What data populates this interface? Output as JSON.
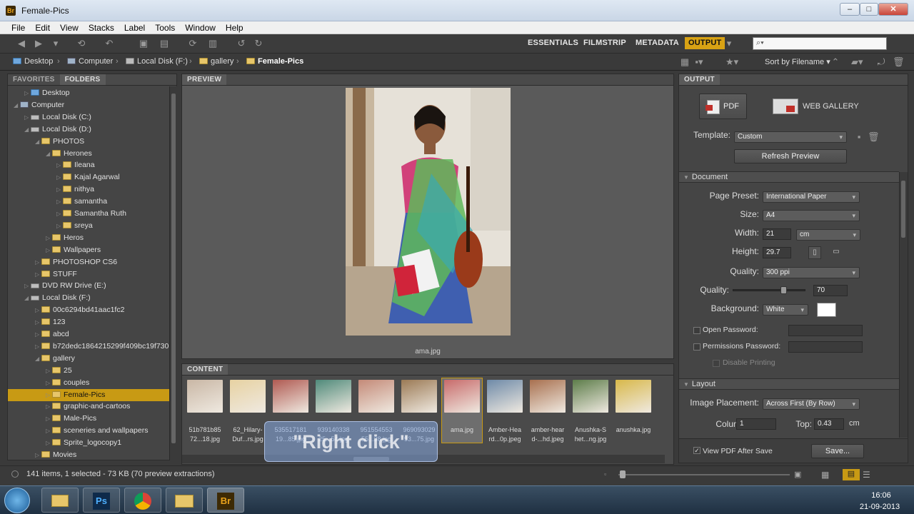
{
  "window": {
    "title": "Female-Pics",
    "app_icon": "Br"
  },
  "menu": [
    "File",
    "Edit",
    "View",
    "Stacks",
    "Label",
    "Tools",
    "Window",
    "Help"
  ],
  "workspaces": [
    "ESSENTIALS",
    "FILMSTRIP",
    "METADATA",
    "OUTPUT"
  ],
  "search": {
    "placeholder": ""
  },
  "path": [
    "Desktop",
    "Computer",
    "Local Disk (F:)",
    "gallery",
    "Female-Pics"
  ],
  "sort_label": "Sort by Filename",
  "left_tabs": [
    "FAVORITES",
    "FOLDERS"
  ],
  "folders": [
    {
      "label": "Desktop",
      "indent": 1,
      "icon": "desktop"
    },
    {
      "label": "Computer",
      "indent": 0,
      "icon": "computer",
      "open": true
    },
    {
      "label": "Local Disk (C:)",
      "indent": 1,
      "icon": "drive"
    },
    {
      "label": "Local Disk (D:)",
      "indent": 1,
      "icon": "drive",
      "open": true
    },
    {
      "label": "PHOTOS",
      "indent": 2,
      "icon": "folder",
      "open": true
    },
    {
      "label": "Herones",
      "indent": 3,
      "icon": "folder",
      "open": true
    },
    {
      "label": "Ileana",
      "indent": 4,
      "icon": "folder"
    },
    {
      "label": "Kajal Agarwal",
      "indent": 4,
      "icon": "folder"
    },
    {
      "label": "nithya",
      "indent": 4,
      "icon": "folder"
    },
    {
      "label": "samantha",
      "indent": 4,
      "icon": "folder"
    },
    {
      "label": "Samantha Ruth",
      "indent": 4,
      "icon": "folder"
    },
    {
      "label": "sreya",
      "indent": 4,
      "icon": "folder"
    },
    {
      "label": "Heros",
      "indent": 3,
      "icon": "folder"
    },
    {
      "label": "Wallpapers",
      "indent": 3,
      "icon": "folder"
    },
    {
      "label": "PHOTOSHOP CS6",
      "indent": 2,
      "icon": "folder"
    },
    {
      "label": "STUFF",
      "indent": 2,
      "icon": "folder"
    },
    {
      "label": "DVD RW Drive (E:)",
      "indent": 1,
      "icon": "drive"
    },
    {
      "label": "Local Disk (F:)",
      "indent": 1,
      "icon": "drive",
      "open": true
    },
    {
      "label": "00c6294bd41aac1fc2",
      "indent": 2,
      "icon": "folder"
    },
    {
      "label": "123",
      "indent": 2,
      "icon": "folder"
    },
    {
      "label": "abcd",
      "indent": 2,
      "icon": "folder"
    },
    {
      "label": "b72dedc1864215299f409bc19f730",
      "indent": 2,
      "icon": "folder"
    },
    {
      "label": "gallery",
      "indent": 2,
      "icon": "folder",
      "open": true
    },
    {
      "label": "25",
      "indent": 3,
      "icon": "folder"
    },
    {
      "label": "couples",
      "indent": 3,
      "icon": "folder"
    },
    {
      "label": "Female-Pics",
      "indent": 3,
      "icon": "folder",
      "selected": true
    },
    {
      "label": "graphic-and-cartoos",
      "indent": 3,
      "icon": "folder"
    },
    {
      "label": "Male-Pics",
      "indent": 3,
      "icon": "folder"
    },
    {
      "label": "sceneries and wallpapers",
      "indent": 3,
      "icon": "folder"
    },
    {
      "label": "Sprite_logocopy1",
      "indent": 3,
      "icon": "folder"
    },
    {
      "label": "Movies",
      "indent": 2,
      "icon": "folder"
    }
  ],
  "preview": {
    "header": "PREVIEW",
    "filename": "ama.jpg"
  },
  "content": {
    "header": "CONTENT",
    "thumbs": [
      {
        "cap": "51b781b85\n72...18.jpg",
        "color": "#c9b7a5"
      },
      {
        "cap": "62_Hilary-\nDuf...rs.jpg",
        "color": "#e7d2a2"
      },
      {
        "cap": "535517181\n19...85.jpg",
        "color": "#b05a52"
      },
      {
        "cap": "939140338\n25...54.jpg",
        "color": "#4f8a7a"
      },
      {
        "cap": "951554553\n55...38.jpg",
        "color": "#c48a78"
      },
      {
        "cap": "969093029\n93...75.jpg",
        "color": "#9b7a55"
      },
      {
        "cap": "ama.jpg",
        "color": "#c86b6b",
        "selected": true
      },
      {
        "cap": "Amber-Hea\nrd...0p.jpeg",
        "color": "#6e8aa8"
      },
      {
        "cap": "amber-hear\nd-...hd.jpeg",
        "color": "#a8704f"
      },
      {
        "cap": "Anushka-S\nhet...ng.jpg",
        "color": "#5d7d4a"
      },
      {
        "cap": "anushka.jpg",
        "color": "#d8b84a"
      }
    ],
    "overlay": "\"Right click\""
  },
  "output": {
    "header": "OUTPUT",
    "pdf_label": "PDF",
    "web_label": "WEB GALLERY",
    "template_label": "Template:",
    "template_value": "Custom",
    "refresh_label": "Refresh Preview",
    "document_section": "Document",
    "page_preset_label": "Page Preset:",
    "page_preset_value": "International Paper",
    "size_label": "Size:",
    "size_value": "A4",
    "width_label": "Width:",
    "width_value": "21",
    "unit_value": "cm",
    "height_label": "Height:",
    "height_value": "29.7",
    "quality_label": "Quality:",
    "quality_value": "300 ppi",
    "quality2_label": "Quality:",
    "quality2_value": "70",
    "quality2_level": 70,
    "background_label": "Background:",
    "background_value": "White",
    "open_password_label": "Open Password:",
    "permissions_password_label": "Permissions Password:",
    "disable_printing_label": "Disable Printing",
    "layout_section": "Layout",
    "placement_label": "Image Placement:",
    "placement_value": "Across First (By Row)",
    "columns_label": "Columns:",
    "columns_value": "1",
    "top_label": "Top:",
    "top_value": "0.43",
    "top_unit": "cm",
    "view_pdf_label": "View PDF After Save",
    "save_label": "Save..."
  },
  "status": {
    "text": "141 items, 1 selected - 73 KB (70 preview extractions)"
  },
  "taskbar": {
    "time": "16:06",
    "date": "21-09-2013"
  },
  "colors": {
    "accent": "#c89a14",
    "panel": "#454545",
    "output_active": "#d8a214"
  }
}
